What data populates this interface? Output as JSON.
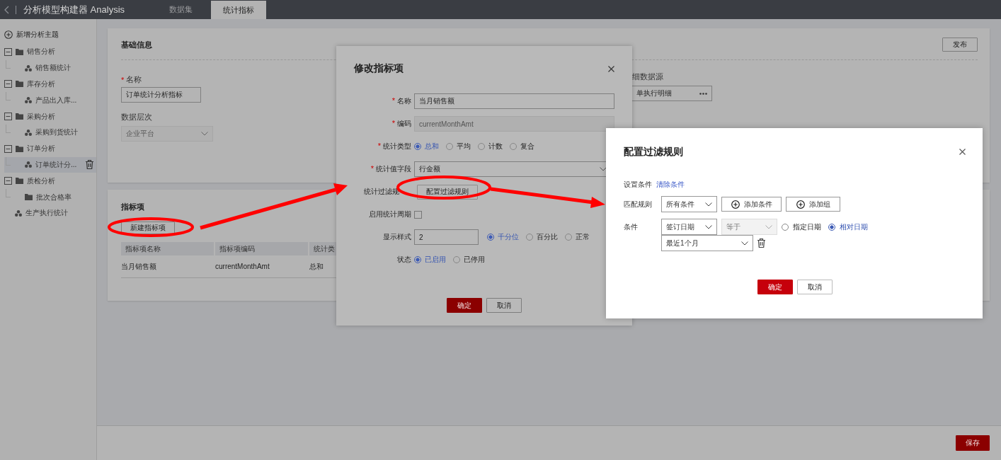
{
  "app": {
    "title": "分析模型构建器 Analysis"
  },
  "tabs": [
    {
      "label": "数据集",
      "selected": false
    },
    {
      "label": "统计指标",
      "selected": true
    }
  ],
  "sidebar": {
    "add_label": "新增分析主题",
    "tree": [
      {
        "label": "销售分析",
        "kind": "folder",
        "expanded": true,
        "selected": false,
        "children": [
          {
            "label": "销售额统计",
            "kind": "metric",
            "selected": false
          }
        ]
      },
      {
        "label": "库存分析",
        "kind": "folder",
        "expanded": true,
        "selected": false,
        "children": [
          {
            "label": "产品出入库...",
            "kind": "metric",
            "selected": false
          }
        ]
      },
      {
        "label": "采购分析",
        "kind": "folder",
        "expanded": true,
        "selected": false,
        "children": [
          {
            "label": "采购到货统计",
            "kind": "metric",
            "selected": false
          }
        ]
      },
      {
        "label": "订单分析",
        "kind": "folder",
        "expanded": true,
        "selected": false,
        "children": [
          {
            "label": "订单统计分...",
            "kind": "metric",
            "selected": true
          }
        ]
      },
      {
        "label": "质检分析",
        "kind": "folder",
        "expanded": true,
        "selected": false,
        "children": [
          {
            "label": "批次合格率",
            "kind": "folder",
            "selected": false
          }
        ]
      },
      {
        "label": "生产执行统计",
        "kind": "metric",
        "selected": false
      }
    ]
  },
  "basic_info": {
    "title": "基础信息",
    "publish_button": "发布",
    "name": {
      "label": "名称",
      "required_mark": "*",
      "value": "订单统计分析指标"
    },
    "level": {
      "label": "数据层次",
      "value": "企业平台",
      "disabled": true
    },
    "source": {
      "label": "细数据源",
      "value": "单执行明细"
    }
  },
  "metrics": {
    "title": "指标项",
    "new_button": "新建指标项",
    "columns": [
      "指标项名称",
      "指标项编码",
      "统计类"
    ],
    "rows": [
      [
        "当月销售额",
        "currentMonthAmt",
        "总和"
      ]
    ]
  },
  "footer": {
    "save_button": "保存"
  },
  "edit_dialog": {
    "title": "修改指标项",
    "rows": [
      {
        "kind": "input",
        "label": "名称",
        "required_mark": "*",
        "value": "当月销售额",
        "disabled": false
      },
      {
        "kind": "input",
        "label": "编码",
        "required_mark": "*",
        "value": "currentMonthAmt",
        "disabled": true
      },
      {
        "kind": "radio",
        "label": "统计类型",
        "required_mark": "*",
        "options": [
          {
            "label": "总和",
            "selected": true
          },
          {
            "label": "平均",
            "selected": false
          },
          {
            "label": "计数",
            "selected": false
          },
          {
            "label": "复合",
            "selected": false
          }
        ]
      },
      {
        "kind": "select",
        "label": "统计值字段",
        "required_mark": "*",
        "value": "行金额"
      },
      {
        "kind": "button",
        "label": "统计过滤规",
        "button": "配置过滤规则"
      },
      {
        "kind": "checkbox",
        "label": "启用统计周期",
        "checked": false
      },
      {
        "kind": "input_radio",
        "label": "显示样式",
        "value": "2",
        "options": [
          {
            "label": "千分位",
            "selected": true
          },
          {
            "label": "百分比",
            "selected": false
          },
          {
            "label": "正常",
            "selected": false
          }
        ]
      },
      {
        "kind": "radio",
        "label": "状态",
        "options": [
          {
            "label": "已启用",
            "selected": true
          },
          {
            "label": "已停用",
            "selected": false
          }
        ]
      }
    ],
    "ok": "确定",
    "cancel": "取消"
  },
  "filter_dialog": {
    "title": "配置过滤规则",
    "set_label": "设置条件",
    "clear_link": "清除条件",
    "match_label": "匹配规则",
    "match_value": "所有条件",
    "add_condition": "添加条件",
    "add_group": "添加组",
    "condition_label": "条件",
    "field": "签订日期",
    "operator": {
      "value": "等于",
      "disabled": true
    },
    "date_modes": [
      {
        "label": "指定日期",
        "selected": false
      },
      {
        "label": "相对日期",
        "selected": true
      }
    ],
    "range": "最近1个月",
    "ok": "确定",
    "cancel": "取消"
  }
}
